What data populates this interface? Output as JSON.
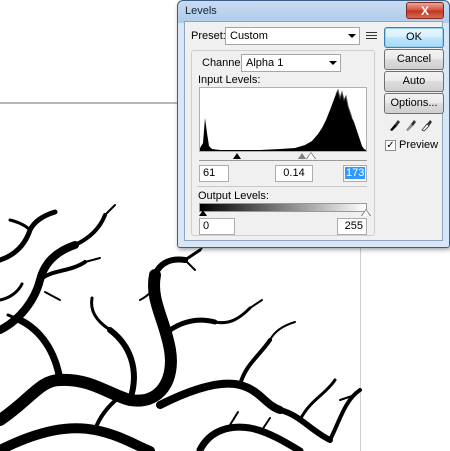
{
  "window": {
    "title": "Levels",
    "close_glyph": "X"
  },
  "preset": {
    "label": "Preset:",
    "value": "Custom",
    "menu_icon": "preset-options-icon"
  },
  "channel": {
    "label": "Channel:",
    "value": "Alpha 1"
  },
  "input_levels": {
    "label": "Input Levels:",
    "black": "61",
    "gamma": "0.14",
    "white": "173"
  },
  "output_levels": {
    "label": "Output Levels:",
    "black": "0",
    "white": "255"
  },
  "buttons": {
    "ok": "OK",
    "cancel": "Cancel",
    "auto": "Auto",
    "options": "Options..."
  },
  "eyedroppers": [
    "black-point-eyedropper-icon",
    "gray-point-eyedropper-icon",
    "white-point-eyedropper-icon"
  ],
  "preview": {
    "label": "Preview",
    "checked": true,
    "glyph": "✓"
  },
  "colors": {
    "title_bar": "#aecbea",
    "close_button": "#c0341f",
    "default_button": "#a7d9f5",
    "selection": "#3399ff"
  }
}
